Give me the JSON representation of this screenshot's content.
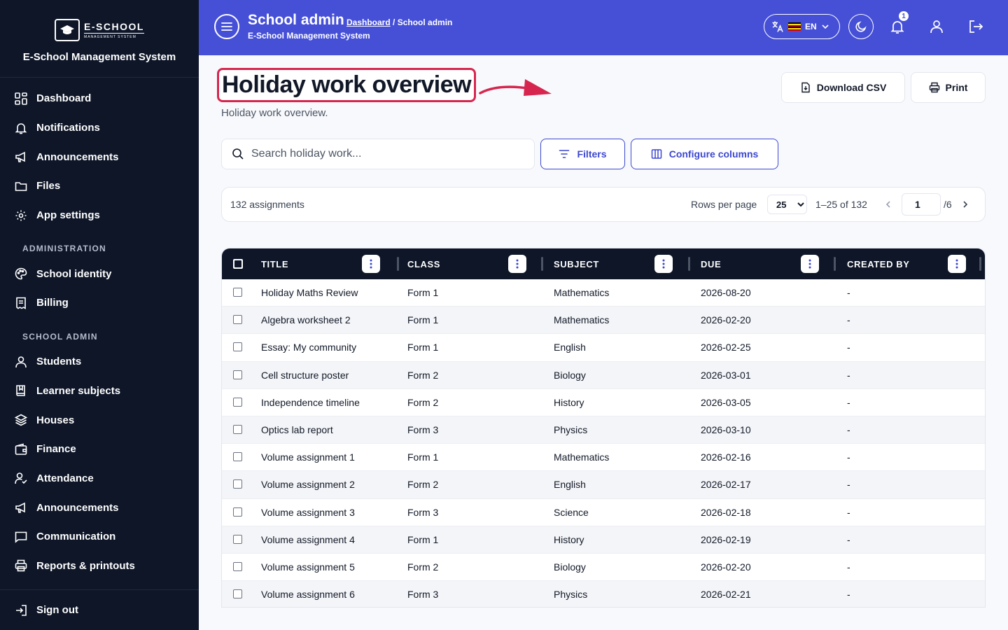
{
  "brand": {
    "logo_main": "E-SCHOOL",
    "logo_sub": "MANAGEMENT SYSTEM",
    "title": "E-School Management System"
  },
  "sidebar": {
    "items": [
      {
        "label": "Dashboard",
        "icon": "dashboard-grid-icon"
      },
      {
        "label": "Notifications",
        "icon": "bell-icon"
      },
      {
        "label": "Announcements",
        "icon": "megaphone-icon"
      },
      {
        "label": "Files",
        "icon": "folder-icon"
      },
      {
        "label": "App settings",
        "icon": "gear-icon"
      }
    ],
    "section_admin": "ADMINISTRATION",
    "admin_items": [
      {
        "label": "School identity",
        "icon": "palette-icon"
      },
      {
        "label": "Billing",
        "icon": "receipt-icon"
      }
    ],
    "section_school": "SCHOOL ADMIN",
    "school_items": [
      {
        "label": "Students",
        "icon": "user-icon"
      },
      {
        "label": "Learner subjects",
        "icon": "book-icon"
      },
      {
        "label": "Houses",
        "icon": "layers-icon"
      },
      {
        "label": "Finance",
        "icon": "wallet-icon"
      },
      {
        "label": "Attendance",
        "icon": "user-check-icon"
      },
      {
        "label": "Announcements",
        "icon": "megaphone-icon"
      },
      {
        "label": "Communication",
        "icon": "message-icon"
      },
      {
        "label": "Reports & printouts",
        "icon": "printer-icon"
      }
    ],
    "signout": "Sign out"
  },
  "header": {
    "title": "School admin",
    "breadcrumb_link": "Dashboard",
    "breadcrumb_rest": " / School admin",
    "subtitle": "E-School Management System",
    "lang": "EN",
    "notifications_count": "1"
  },
  "page": {
    "title": "Holiday work overview",
    "subtitle": "Holiday work overview.",
    "download_csv": "Download CSV",
    "print": "Print",
    "search_placeholder": "Search holiday work...",
    "filters": "Filters",
    "configure_columns": "Configure columns"
  },
  "pager": {
    "count": "132 assignments",
    "rows_per_page_label": "Rows per page",
    "rows_per_page": "25",
    "range": "1–25 of 132",
    "page": "1",
    "total_pages": "/6"
  },
  "table": {
    "columns": [
      "TITLE",
      "CLASS",
      "SUBJECT",
      "DUE",
      "CREATED BY"
    ],
    "rows": [
      [
        "Holiday Maths Review",
        "Form 1",
        "Mathematics",
        "2026-08-20",
        "-"
      ],
      [
        "Algebra worksheet 2",
        "Form 1",
        "Mathematics",
        "2026-02-20",
        "-"
      ],
      [
        "Essay: My community",
        "Form 1",
        "English",
        "2026-02-25",
        "-"
      ],
      [
        "Cell structure poster",
        "Form 2",
        "Biology",
        "2026-03-01",
        "-"
      ],
      [
        "Independence timeline",
        "Form 2",
        "History",
        "2026-03-05",
        "-"
      ],
      [
        "Optics lab report",
        "Form 3",
        "Physics",
        "2026-03-10",
        "-"
      ],
      [
        "Volume assignment 1",
        "Form 1",
        "Mathematics",
        "2026-02-16",
        "-"
      ],
      [
        "Volume assignment 2",
        "Form 2",
        "English",
        "2026-02-17",
        "-"
      ],
      [
        "Volume assignment 3",
        "Form 3",
        "Science",
        "2026-02-18",
        "-"
      ],
      [
        "Volume assignment 4",
        "Form 1",
        "History",
        "2026-02-19",
        "-"
      ],
      [
        "Volume assignment 5",
        "Form 2",
        "Biology",
        "2026-02-20",
        "-"
      ],
      [
        "Volume assignment 6",
        "Form 3",
        "Physics",
        "2026-02-21",
        "-"
      ]
    ]
  },
  "colors": {
    "sidebar_bg": "#0e1628",
    "header_bg": "#4650d6",
    "accent": "#3b47d1",
    "highlight": "#d6264f"
  }
}
